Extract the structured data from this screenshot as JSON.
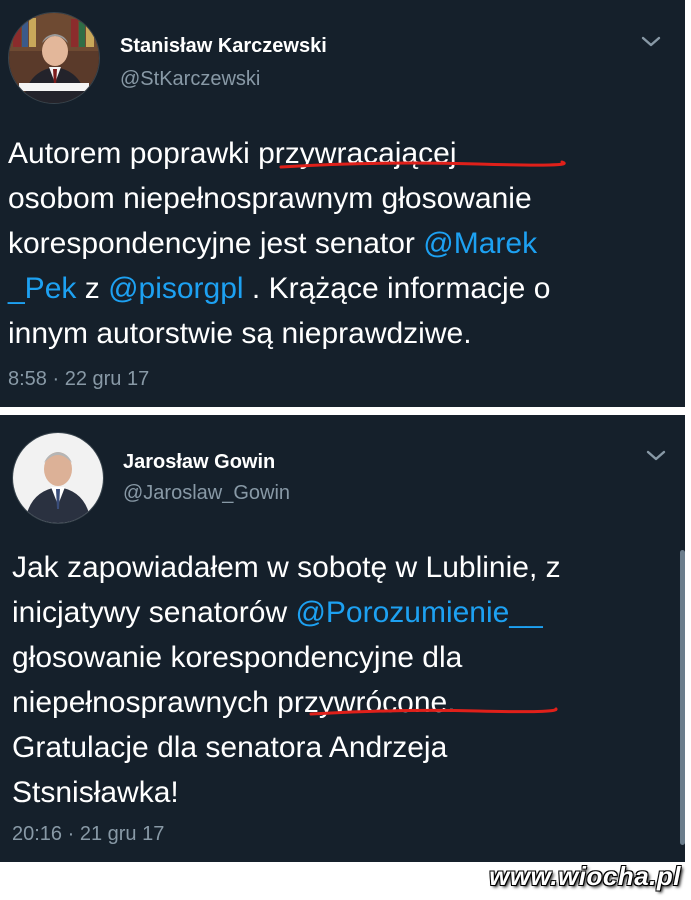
{
  "tweets": [
    {
      "author_name": "Stanisław Karczewski",
      "author_handle": "@StKarczewski",
      "avatar_icon": "person-suit-bookshelf-avatar",
      "body": {
        "l1_a": "Autorem poprawki ",
        "l1_b": "przywracającej",
        "l2": "osobom niepełnosprawnym głosowanie",
        "l3_a": "korespondencyjne jest senator ",
        "l3_mention": "@Marek",
        "l4_mention": "_Pek",
        "l4_a": " z ",
        "l4_mention2": "@pisorgpl",
        "l4_b": " . Krążące informacje o",
        "l5": "innym autorstwie są nieprawdziwe."
      },
      "timestamp": "8:58 · 22 gru 17"
    },
    {
      "author_name": "Jarosław Gowin",
      "author_handle": "@Jaroslaw_Gowin",
      "avatar_icon": "person-suit-white-background-avatar",
      "body": {
        "l1": "Jak zapowiadałem w sobotę w Lublinie, z",
        "l2_a": "inicjatywy senatorów ",
        "l2_mention": "@Porozumienie__",
        "l3": "głosowanie korespondencyjne dla",
        "l4_a": "niepełnosprawnych ",
        "l4_b": "przywrócone.",
        "l5": "Gratulacje dla senatora Andrzeja",
        "l6": "Stsnisławka!"
      },
      "timestamp": "20:16 · 21 gru 17"
    }
  ],
  "watermark": "www.wiocha.pl",
  "colors": {
    "background": "#15202b",
    "text": "#ffffff",
    "secondary": "#8899a6",
    "mention": "#1da1f2",
    "underline": "#e0201a"
  }
}
